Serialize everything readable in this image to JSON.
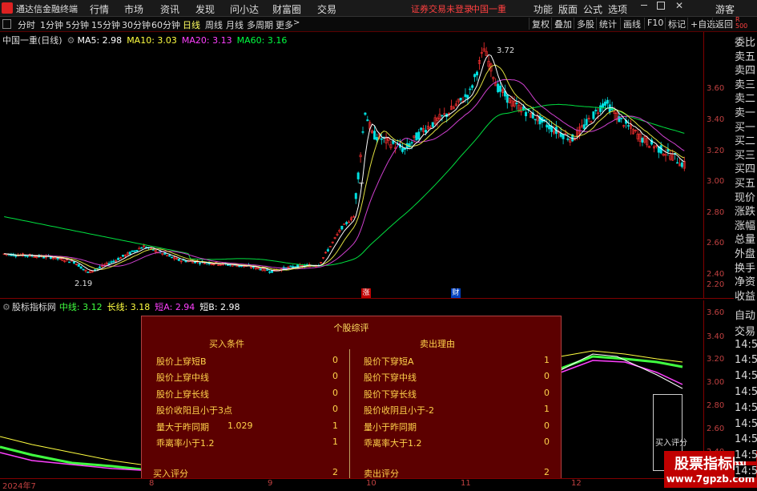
{
  "menubar": {
    "app_title": "通达信金融终端",
    "items": [
      "行情",
      "市场",
      "资讯",
      "发现",
      "问小达",
      "财富圈",
      "交易"
    ],
    "warning": "证券交易未登录",
    "stock": "中国一重",
    "right_items": [
      "功能",
      "版面",
      "公式",
      "选项"
    ],
    "guest": "游客"
  },
  "periodbar": {
    "periods": [
      "分时",
      "1分钟",
      "5分钟",
      "15分钟",
      "30分钟",
      "60分钟",
      "日线",
      "周线",
      "月线",
      "多周期",
      "更多"
    ],
    "active": "日线",
    "tools": [
      "复权",
      "叠加",
      "多股",
      "统计",
      "画线",
      "F10",
      "标记",
      "+自选",
      "返回"
    ]
  },
  "main_legend": {
    "name": "中国一重(日线)",
    "ma5": "MA5: 2.98",
    "ma10": "MA10: 3.03",
    "ma20": "MA20: 3.13",
    "ma60": "MA60: 3.16"
  },
  "annotations": {
    "high": "3.72",
    "low": "2.19",
    "t_mark": "T",
    "zhang": "涨",
    "cai": "财"
  },
  "y_ticks": [
    "3.60",
    "3.40",
    "3.20",
    "3.00",
    "2.80",
    "2.60",
    "2.40",
    "2.20"
  ],
  "ind_legend": {
    "name": "股标指标网",
    "mid": "中线: 3.12",
    "long": "长线: 3.18",
    "short_a": "短A: 2.94",
    "short_b": "短B: 2.98"
  },
  "ind_y_ticks": [
    "3.60",
    "3.40",
    "3.20",
    "3.00",
    "2.80",
    "2.60",
    "2.40"
  ],
  "right_panel": [
    "委比",
    "卖五",
    "卖四",
    "卖三",
    "卖二",
    "卖一",
    "买一",
    "买二",
    "买三",
    "买四",
    "买五",
    "现价",
    "涨跌",
    "涨幅",
    "总量",
    "外盘",
    "换手",
    "净资",
    "收益"
  ],
  "right_panel2": [
    "自动",
    "交易",
    "14:5",
    "14:5",
    "14:5",
    "14:5",
    "14:5",
    "14:5",
    "14:5",
    "14:5",
    "14:5"
  ],
  "x_ticks": [
    "2024年7",
    "8",
    "9",
    "10",
    "11",
    "12"
  ],
  "popup": {
    "title": "个股综评",
    "buy_header": "买入条件",
    "sell_header": "卖出理由",
    "buy_rows": [
      {
        "label": "股价上穿短B",
        "val": "",
        "flag": "0"
      },
      {
        "label": "股价上穿中线",
        "val": "",
        "flag": "0"
      },
      {
        "label": "股价上穿长线",
        "val": "",
        "flag": "0"
      },
      {
        "label": "股价收阳且小于3点",
        "val": "",
        "flag": "0"
      },
      {
        "label": "量大于昨同期",
        "val": "1.029",
        "flag": "1"
      },
      {
        "label": "乖离率小于1.2",
        "val": "",
        "flag": "1"
      }
    ],
    "sell_rows": [
      {
        "label": "股价下穿短A",
        "flag": "1"
      },
      {
        "label": "股价下穿中线",
        "flag": "0"
      },
      {
        "label": "股价下穿长线",
        "flag": "0"
      },
      {
        "label": "股价收阴且小于-2",
        "flag": "1"
      },
      {
        "label": "量小于昨同期",
        "flag": "0"
      },
      {
        "label": "乖离率大于1.2",
        "flag": "0"
      }
    ],
    "buy_score_label": "买入评分",
    "buy_score": "2",
    "sell_score_label": "卖出评分",
    "sell_score": "2"
  },
  "buy_box_label": "买入评分",
  "watermark": {
    "line1": "股票指标网",
    "line2": "www.7gpzb.com"
  },
  "colors": {
    "up": "#ff3030",
    "down": "#00e0e0",
    "ma5": "#ffffff",
    "ma10": "#ffff40",
    "ma20": "#ff40ff",
    "ma60": "#00ff40"
  }
}
